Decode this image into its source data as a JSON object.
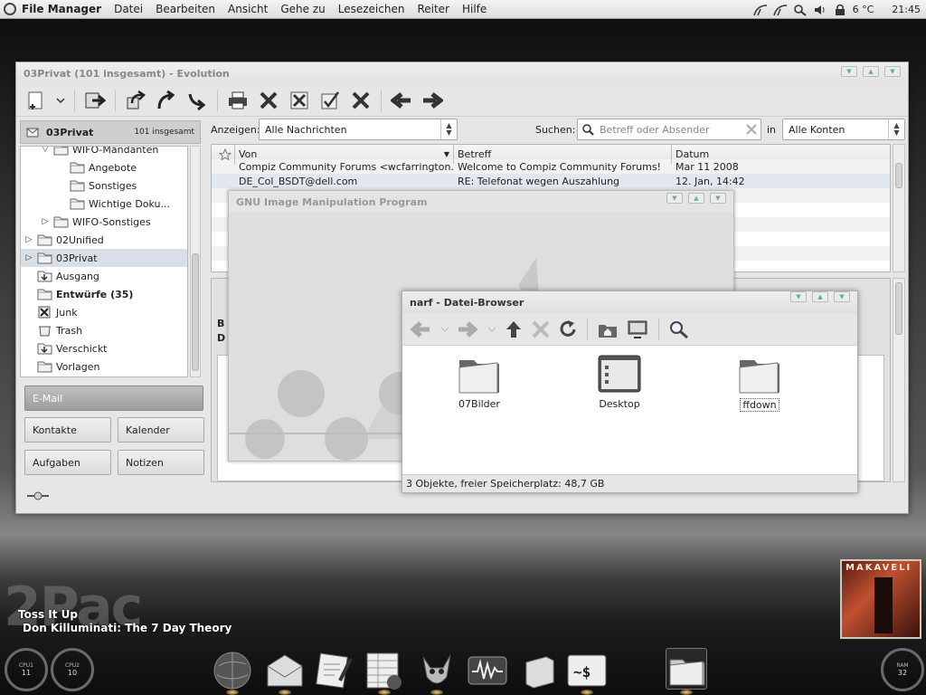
{
  "top_panel": {
    "app_name": "File Manager",
    "menus": [
      "Datei",
      "Bearbeiten",
      "Ansicht",
      "Gehe zu",
      "Lesezeichen",
      "Reiter",
      "Hilfe"
    ],
    "temperature": "6 °C",
    "clock": "21:45"
  },
  "evolution": {
    "title": "03Privat (101 insgesamt) - Evolution",
    "folder_header": {
      "name": "03Privat",
      "count": "101 insgesamt"
    },
    "folders": [
      {
        "label": "WIFO-Mandanten",
        "indent": 1,
        "expander": "open",
        "bold": false
      },
      {
        "label": "Angebote",
        "indent": 2,
        "expander": "",
        "bold": false
      },
      {
        "label": "Sonstiges",
        "indent": 2,
        "expander": "",
        "bold": false
      },
      {
        "label": "Wichtige Doku...",
        "indent": 2,
        "expander": "",
        "bold": false
      },
      {
        "label": "WIFO-Sonstiges",
        "indent": 1,
        "expander": "closed",
        "bold": false
      },
      {
        "label": "02Unified",
        "indent": 0,
        "expander": "closed",
        "bold": false
      },
      {
        "label": "03Privat",
        "indent": 0,
        "expander": "closed",
        "bold": false,
        "selected": true
      },
      {
        "label": "Ausgang",
        "indent": 0,
        "expander": "",
        "bold": false
      },
      {
        "label": "Entwürfe (35)",
        "indent": 0,
        "expander": "",
        "bold": true
      },
      {
        "label": "Junk",
        "indent": 0,
        "expander": "",
        "bold": false
      },
      {
        "label": "Trash",
        "indent": 0,
        "expander": "",
        "bold": false
      },
      {
        "label": "Verschickt",
        "indent": 0,
        "expander": "",
        "bold": false
      },
      {
        "label": "Vorlagen",
        "indent": 0,
        "expander": "",
        "bold": false
      }
    ],
    "switcher": {
      "email": "E-Mail",
      "contacts": "Kontakte",
      "calendar": "Kalender",
      "tasks": "Aufgaben",
      "notes": "Notizen"
    },
    "filter": {
      "show_label": "Anzeigen:",
      "show_value": "Alle Nachrichten",
      "search_label": "Suchen:",
      "search_placeholder": "Betreff oder Absender",
      "in_label": "in",
      "account_value": "Alle Konten"
    },
    "columns": {
      "from": "Von",
      "subject": "Betreff",
      "date": "Datum"
    },
    "messages": [
      {
        "from": "Compiz Community Forums <wcfarrington...",
        "subject": "Welcome to Compiz Community Forums!",
        "date": "Mar 11 2008"
      },
      {
        "from": "DE_Col_BSDT@dell.com",
        "subject": "RE: Telefonat wegen Auszahlung",
        "date": "12. Jan, 14:42"
      }
    ]
  },
  "gimp": {
    "title": "GNU Image Manipulation Program"
  },
  "browser": {
    "title": "narf - Datei-Browser",
    "items": [
      {
        "label": "07Bilder",
        "type": "folder"
      },
      {
        "label": "Desktop",
        "type": "desktop"
      },
      {
        "label": "ffdown",
        "type": "folder",
        "selected": true
      }
    ],
    "status": "3 Objekte, freier Speicherplatz: 48,7 GB"
  },
  "desktop": {
    "artist_watermark": "2Pac",
    "track": "Toss It Up",
    "album": "Don Killuminati: The 7 Day Theory",
    "album_art_text": "MAKAVELI",
    "gauges": [
      {
        "label": "CPU1",
        "value": "11"
      },
      {
        "label": "CPU2",
        "value": "10"
      },
      {
        "label": "RAM",
        "value": "32"
      }
    ],
    "dock_items": [
      "globe-icon",
      "mail-icon",
      "editor-icon",
      "spreadsheet-icon",
      "gimp-icon",
      "system-monitor-icon",
      "box-icon",
      "terminal-icon",
      "folder-icon"
    ]
  },
  "colors": {
    "accent": "#d9dfe6",
    "panel": "#e6e6e6",
    "active_button": "#a8a8a8"
  }
}
